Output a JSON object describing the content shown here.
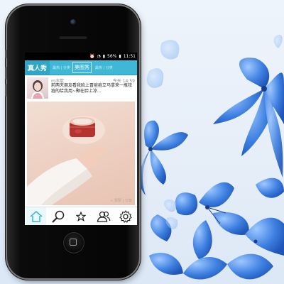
{
  "status_bar": {
    "battery": "56%",
    "time": "11:51"
  },
  "tabs": [
    {
      "label": "真人秀",
      "active": true
    },
    {
      "label": "最热 | 分类",
      "active": false
    },
    {
      "label": "美图秀",
      "active": false
    },
    {
      "label": "最热 | 分类",
      "active": false
    }
  ],
  "post": {
    "username": "m冰歆",
    "timestamp": "今天 14:59",
    "text": "前两天朋友看我脸上冒痘痘立马拿来一瓶祛痘的给我用~颗在脸上凉...",
    "overlay_label": "∞ 赞赞 | 分享"
  },
  "bottom_nav": [
    {
      "icon": "home-icon",
      "active": true
    },
    {
      "icon": "search-icon",
      "active": false
    },
    {
      "icon": "star-icon",
      "active": false
    },
    {
      "icon": "users-icon",
      "active": false
    },
    {
      "icon": "gear-icon",
      "active": false
    }
  ],
  "colors": {
    "accent": "#3fb8d6",
    "flower": "#3d7fe0"
  }
}
